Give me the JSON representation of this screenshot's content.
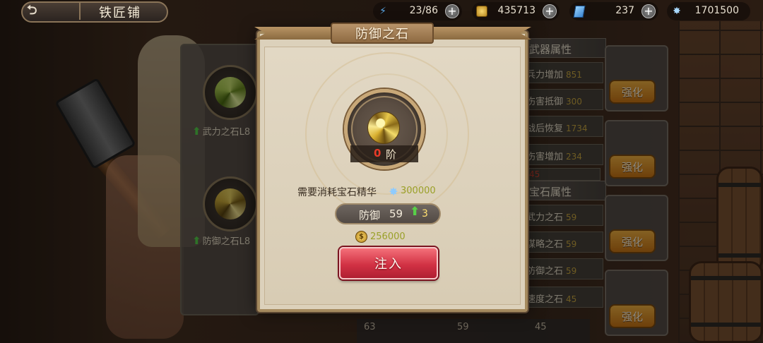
{
  "top_bar": {
    "title": "铁匠铺",
    "resources": [
      {
        "icon": "lightning-icon",
        "value": "23/86"
      },
      {
        "icon": "gold-coin-icon",
        "value": "435713"
      },
      {
        "icon": "crystal-icon",
        "value": "237"
      },
      {
        "icon": "essence-icon",
        "value": "1701500"
      }
    ]
  },
  "left_panel": {
    "gems": [
      {
        "label": "武力之石L8"
      },
      {
        "label": "防御之石L8"
      }
    ]
  },
  "right_panel": {
    "weapon_section": "武器属性",
    "weapon_stats": [
      {
        "name": "兵力增加",
        "value": "851"
      },
      {
        "name": "伤害抵御",
        "value": "300"
      },
      {
        "name": "战后恢复",
        "value": "1734"
      },
      {
        "name": "伤害增加",
        "value": "234"
      }
    ],
    "gem_section": "宝石属性",
    "gem_stats": [
      {
        "name": "武力之石",
        "value": "59"
      },
      {
        "name": "谋略之石",
        "value": "59"
      },
      {
        "name": "防御之石",
        "value": "59"
      },
      {
        "name": "速度之石",
        "value": "45"
      }
    ],
    "enhance_label": "强化",
    "partial_value": "45",
    "bottom_values": [
      "63",
      "59",
      "45"
    ]
  },
  "modal": {
    "title": "防御之石",
    "rank_value": "0",
    "rank_unit": "阶",
    "cost_label": "需要消耗宝石精华",
    "cost_value": "300000",
    "stat_name": "防御",
    "stat_value": "59",
    "stat_increase": "3",
    "gold_cost": "256000",
    "inject_label": "注入"
  },
  "colors": {
    "enhance_button": "#e0962a",
    "inject_button": "#d23244",
    "rank_value": "#e83a28",
    "increase_arrow": "#58d048"
  }
}
